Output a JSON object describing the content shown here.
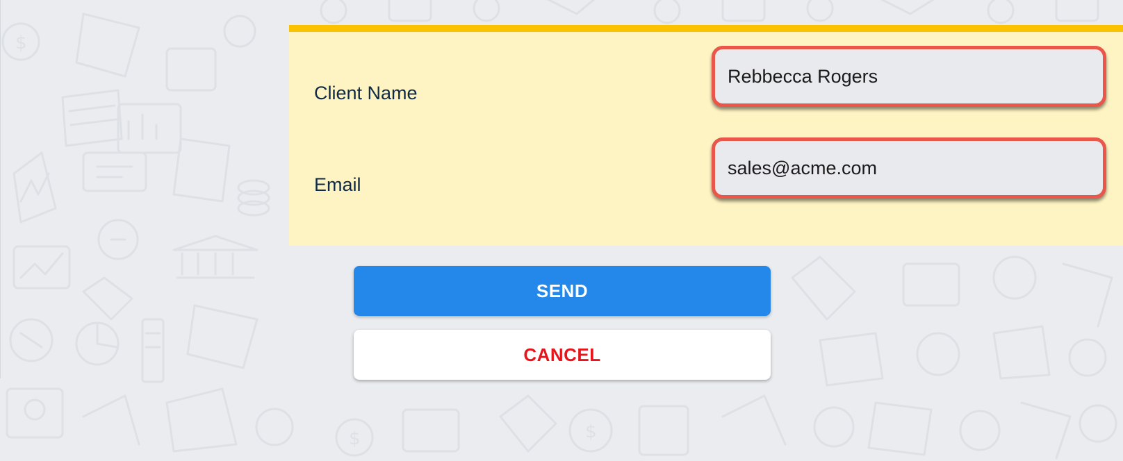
{
  "form": {
    "client_name_label": "Client Name",
    "client_name_value": "Rebbecca Rogers",
    "email_label": "Email",
    "email_value": "sales@acme.com"
  },
  "actions": {
    "send_label": "SEND",
    "cancel_label": "CANCEL"
  },
  "colors": {
    "page_background": "#eaecef",
    "panel_background": "#fef3c2",
    "panel_accent": "#fbc200",
    "input_border": "#e8574a",
    "send_button": "#2388ea",
    "cancel_text": "#e8141b",
    "label_text": "#0f2a47"
  }
}
